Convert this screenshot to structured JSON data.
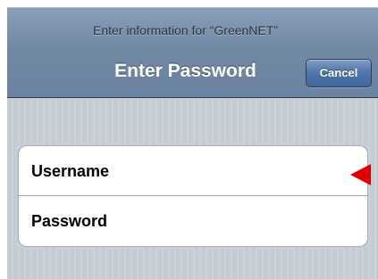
{
  "nav_bar": {
    "prompt": "Enter information for “GreenNET”",
    "title": "Enter Password",
    "cancel_label": "Cancel"
  },
  "form": {
    "fields": [
      {
        "label": "Username"
      },
      {
        "label": "Password"
      }
    ]
  },
  "annotation": {
    "icon": "red-arrow-pointer",
    "color": "#e00000"
  },
  "colors": {
    "nav_bar": "#7289a5",
    "cancel_button": "#4f74a8",
    "background": "#c5ccd4"
  }
}
